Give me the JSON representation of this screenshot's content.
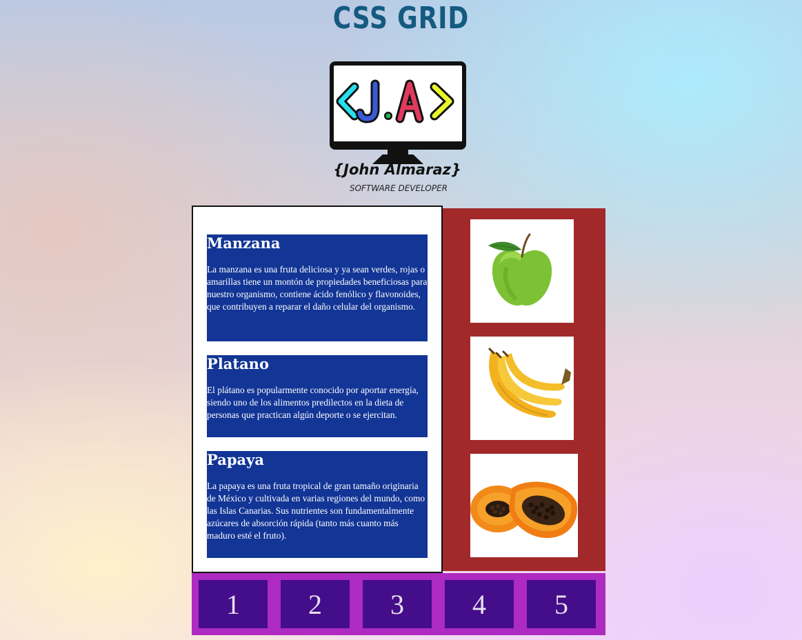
{
  "header": {
    "title": "CSS GRID"
  },
  "logo": {
    "mark_text": "<J.A>",
    "name": "{John Almaraz}",
    "tagline": "SOFTWARE DEVELOPER",
    "colors": {
      "left_bracket": "#27e0ee",
      "J": "#3a5bd8",
      "dot": "#2ab04a",
      "A": "#e03a5e",
      "right_bracket": "#e8f52a"
    }
  },
  "cards": [
    {
      "title": "Manzana",
      "text": "La manzana es una fruta deliciosa y ya sean verdes, rojas o amarillas tiene un montón de propiedades beneficiosas para nuestro organismo, contiene ácido fenólico y flavonoides, que contribuyen a reparar el daño celular del organismo."
    },
    {
      "title": "Platano",
      "text": "El plátano es popularmente conocido por aportar energía, siendo uno de los alimentos predilectos en la dieta de personas que practican algún deporte o se ejercitan."
    },
    {
      "title": "Papaya",
      "text": "La papaya es una fruta tropical de gran tamaño originaria de México y cultivada en varias regiones del mundo, como las Islas Canarias. Sus nutrientes son fundamentalmente azúcares de absorción rápida (tanto más cuanto más maduro esté el fruto)."
    }
  ],
  "gallery": {
    "background": "#a2292a",
    "images": [
      "green-apple",
      "banana-bunch",
      "papaya-halves"
    ]
  },
  "footer": {
    "background": "#ad2bc0",
    "box_color": "#440d8a",
    "items": [
      "1",
      "2",
      "3",
      "4",
      "5"
    ]
  }
}
